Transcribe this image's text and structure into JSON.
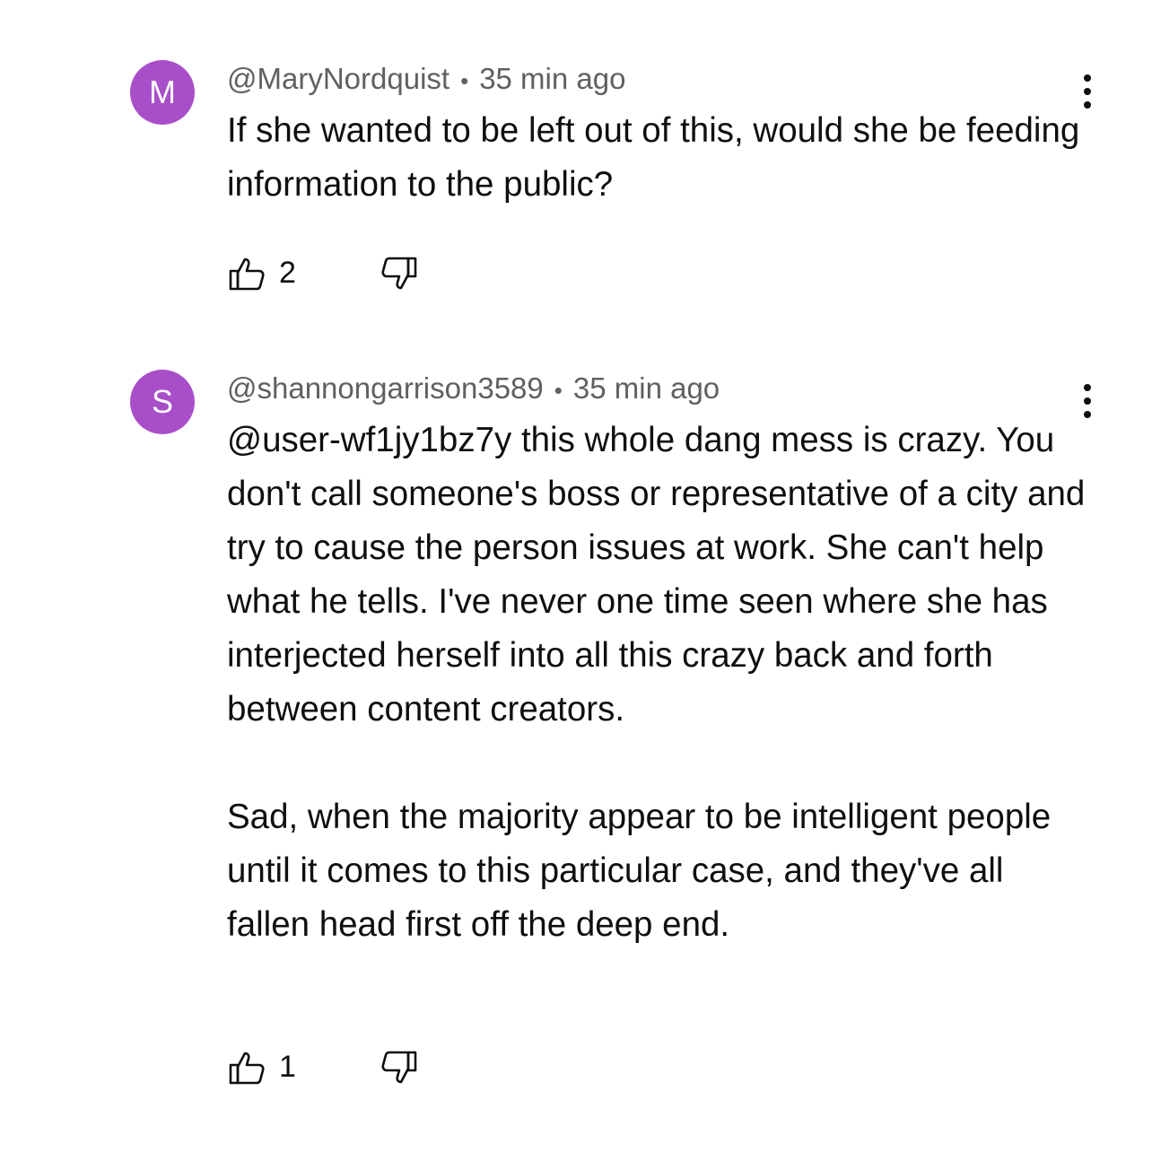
{
  "comments": [
    {
      "avatar_letter": "M",
      "avatar_color": "#a94ec9",
      "author": "@MaryNordquist",
      "separator": "•",
      "time": "35 min ago",
      "paragraphs": [
        "If she wanted to be left out of this, would she be feeding information to the public?"
      ],
      "likes": "2",
      "menu_icon": "more-vertical-icon"
    },
    {
      "avatar_letter": "S",
      "avatar_color": "#a94ec9",
      "author": "@shannongarrison3589",
      "separator": "•",
      "time": "35 min ago",
      "paragraphs": [
        "@user-wf1jy1bz7y  this whole dang mess is crazy. You don't call someone's boss or representative of a city and try to cause the person issues at work. She can't help what he tells. I've never one time seen where she has interjected herself into all this crazy back and forth between content creators.",
        "Sad, when the majority appear to be intelligent people until it comes to this particular case, and they've all fallen head first off the deep end."
      ],
      "likes": "1",
      "menu_icon": "more-vertical-icon"
    }
  ],
  "icons": {
    "like": "thumbs-up-icon",
    "dislike": "thumbs-down-icon"
  }
}
